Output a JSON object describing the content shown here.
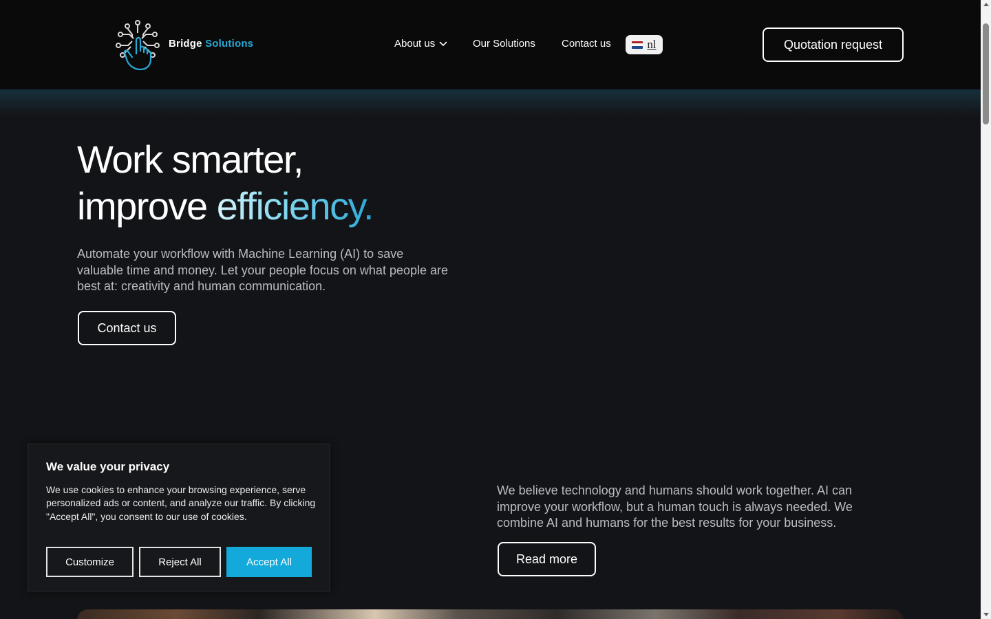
{
  "header": {
    "brand_primary": "Bridge",
    "brand_accent": "Solutions",
    "logo_icon": "circuit-hand-icon",
    "nav": {
      "about": "About us",
      "solutions": "Our Solutions",
      "contact": "Contact us"
    },
    "language": {
      "code": "nl",
      "flag_icon": "netherlands-flag-icon"
    },
    "quote_button": "Quotation request"
  },
  "hero": {
    "title_line1": "Work smarter,",
    "title_line2_plain": "improve ",
    "title_line2_accent": "efficiency.",
    "text": "Automate your workflow with Machine Learning (AI) to save valuable time and money. Let your people focus on what people are best at: creativity and human communication.",
    "contact_button": "Contact us"
  },
  "belief": {
    "text": "We believe technology and humans should work together. AI can improve your workflow, but a human touch is always needed. We combine AI and humans for the best results for your business.",
    "read_more_button": "Read more"
  },
  "cookie_banner": {
    "title": "We value your privacy",
    "text": "We use cookies to enhance your browsing experience, serve personalized ads or content, and analyze our traffic. By clicking \"Accept All\", you consent to our use of cookies.",
    "customize": "Customize",
    "reject": "Reject All",
    "accept": "Accept All"
  },
  "colors": {
    "accent": "#29a9d6",
    "accept_button": "#13a9db",
    "background": "#131417",
    "header_background": "#0a0a0a"
  }
}
